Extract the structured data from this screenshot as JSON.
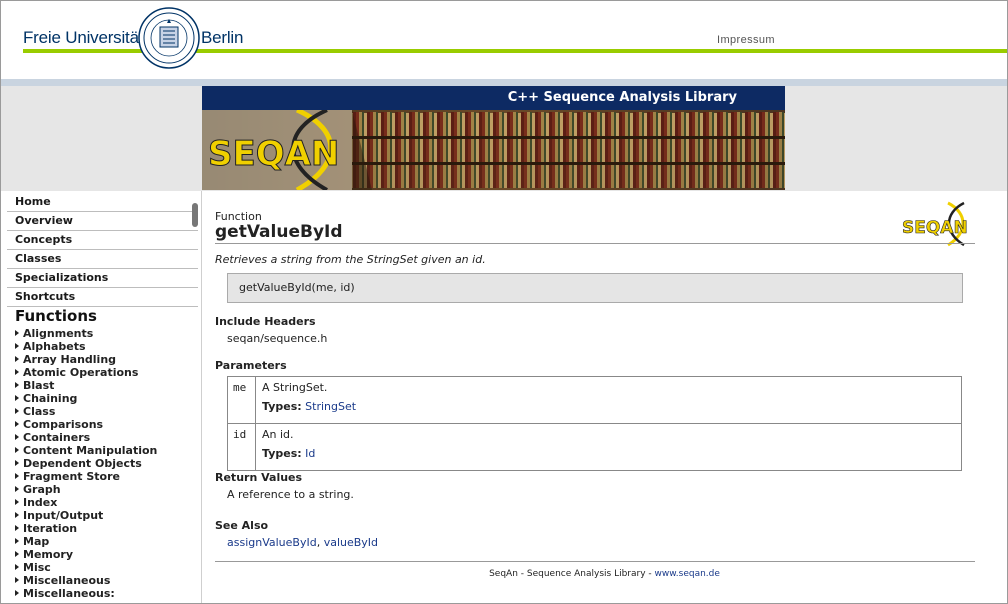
{
  "header": {
    "left_text": "Freie Universität",
    "right_text": "Berlin",
    "impressum": "Impressum"
  },
  "banner": {
    "title": "C++ Sequence Analysis Library",
    "logo_text": "SEQAN"
  },
  "sidebar": {
    "nav": [
      "Home",
      "Overview",
      "Concepts",
      "Classes",
      "Specializations",
      "Shortcuts"
    ],
    "functions_heading": "Functions",
    "functions": [
      "Alignments",
      "Alphabets",
      "Array Handling",
      "Atomic Operations",
      "Blast",
      "Chaining",
      "Class",
      "Comparisons",
      "Containers",
      "Content Manipulation",
      "Dependent Objects",
      "Fragment Store",
      "Graph",
      "Index",
      "Input/Output",
      "Iteration",
      "Map",
      "Memory",
      "Misc",
      "Miscellaneous",
      "Miscellaneous:"
    ]
  },
  "main": {
    "kind": "Function",
    "name": "getValueById",
    "summary": "Retrieves a string from the StringSet given an id.",
    "signature": "getValueById(me, id)",
    "include_heading": "Include Headers",
    "include_value": "seqan/sequence.h",
    "params_heading": "Parameters",
    "params": [
      {
        "name": "me",
        "desc": "A StringSet.",
        "types_label": "Types:",
        "types_value": "StringSet"
      },
      {
        "name": "id",
        "desc": "An id.",
        "types_label": "Types:",
        "types_value": "Id"
      }
    ],
    "return_heading": "Return Values",
    "return_value": "A reference to a string.",
    "see_also_heading": "See Also",
    "see_also": [
      "assignValueById",
      "valueById"
    ],
    "see_also_sep": ",",
    "footer_text": "SeqAn - Sequence Analysis Library - ",
    "footer_link": "www.seqan.de"
  },
  "colors": {
    "fu_blue": "#003366",
    "fu_green": "#99cc00",
    "banner_navy": "#0d2a63",
    "link": "#1a3a8a"
  }
}
